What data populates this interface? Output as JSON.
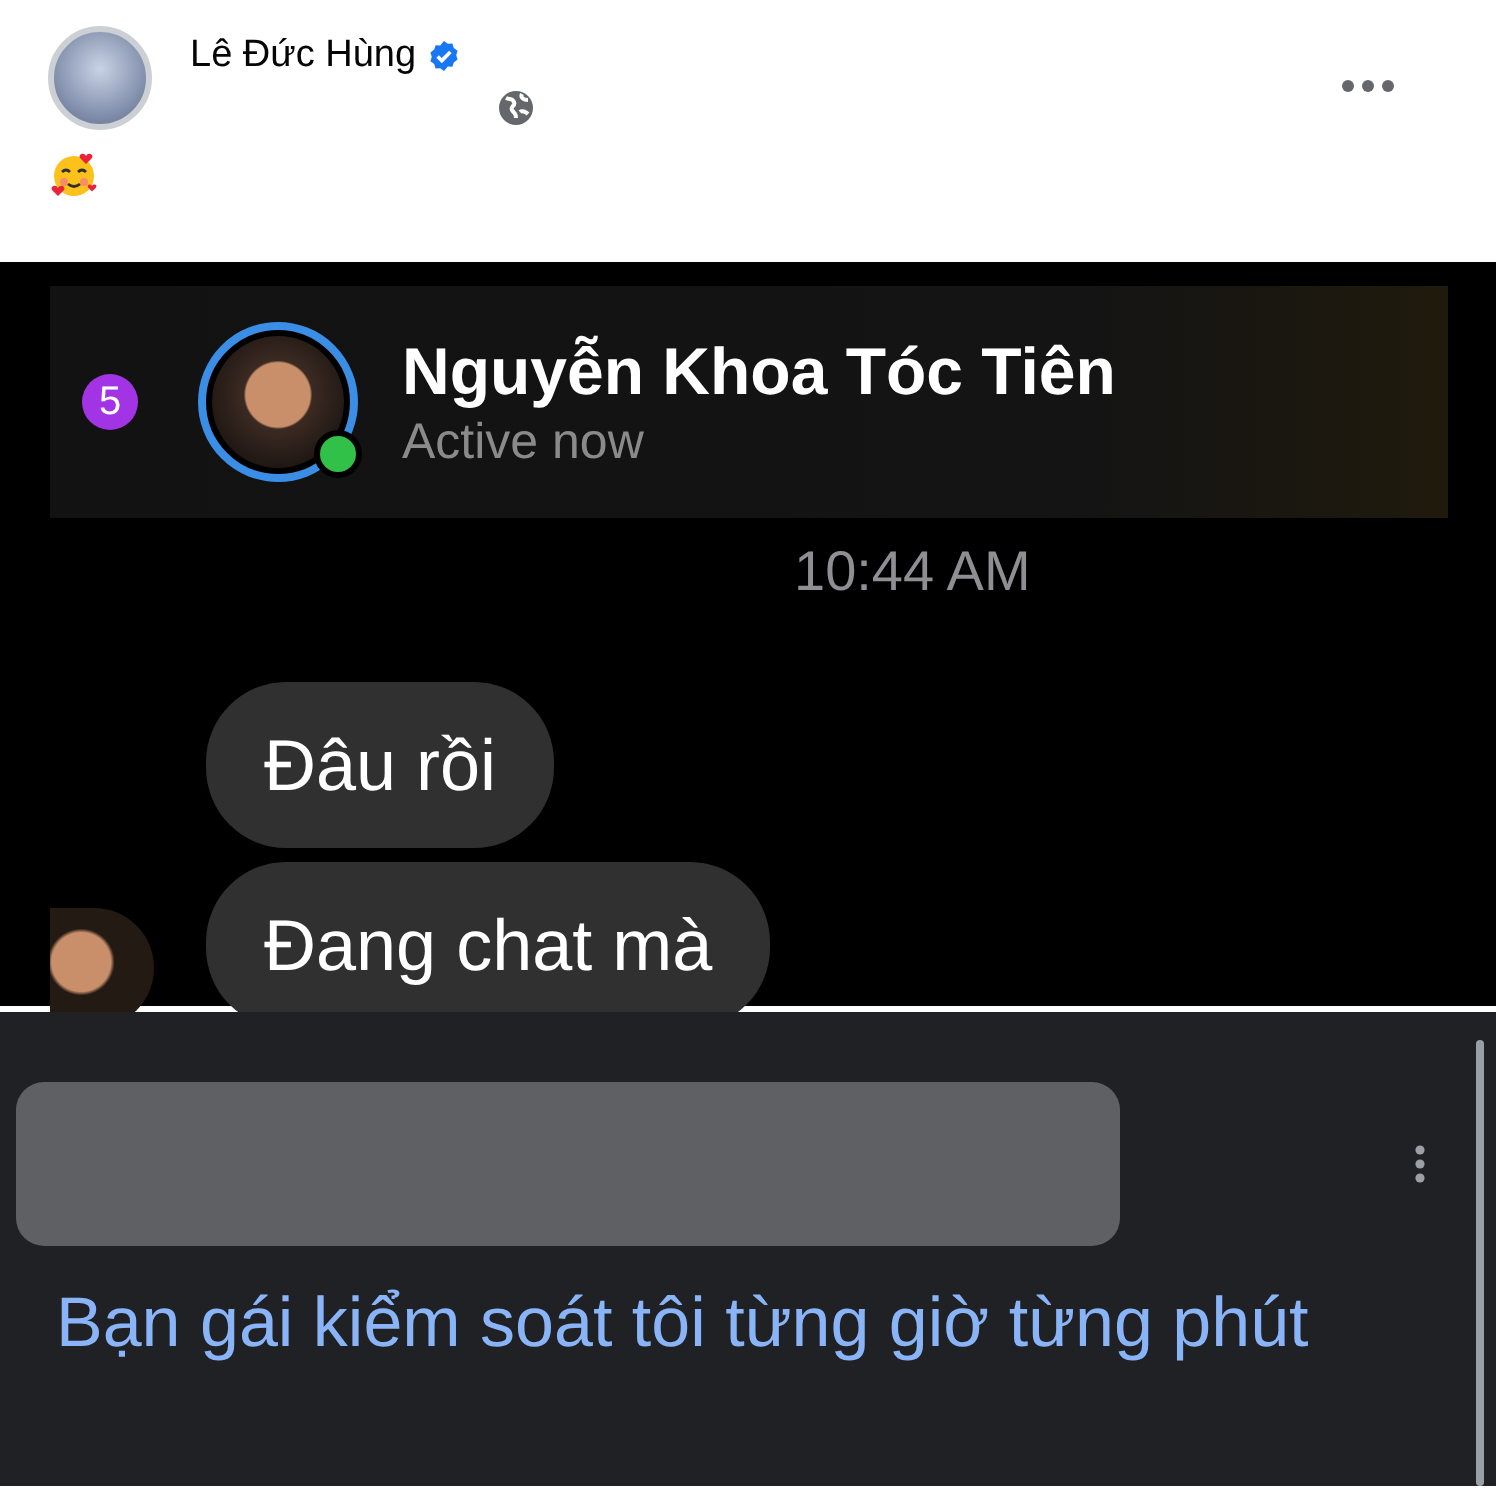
{
  "post": {
    "author": "Lê Đức Hùng",
    "verified": true
  },
  "chat": {
    "contact": "Nguyễn Khoa Tóc Tiên",
    "status": "Active now",
    "unread_count": "5",
    "online": true,
    "time": "10:44 AM",
    "messages": [
      {
        "text": "Đâu rồi"
      },
      {
        "text": "Đang chat mà"
      }
    ]
  },
  "search_result": {
    "title": "Bạn gái kiểm soát tôi từng giờ từng phút"
  }
}
